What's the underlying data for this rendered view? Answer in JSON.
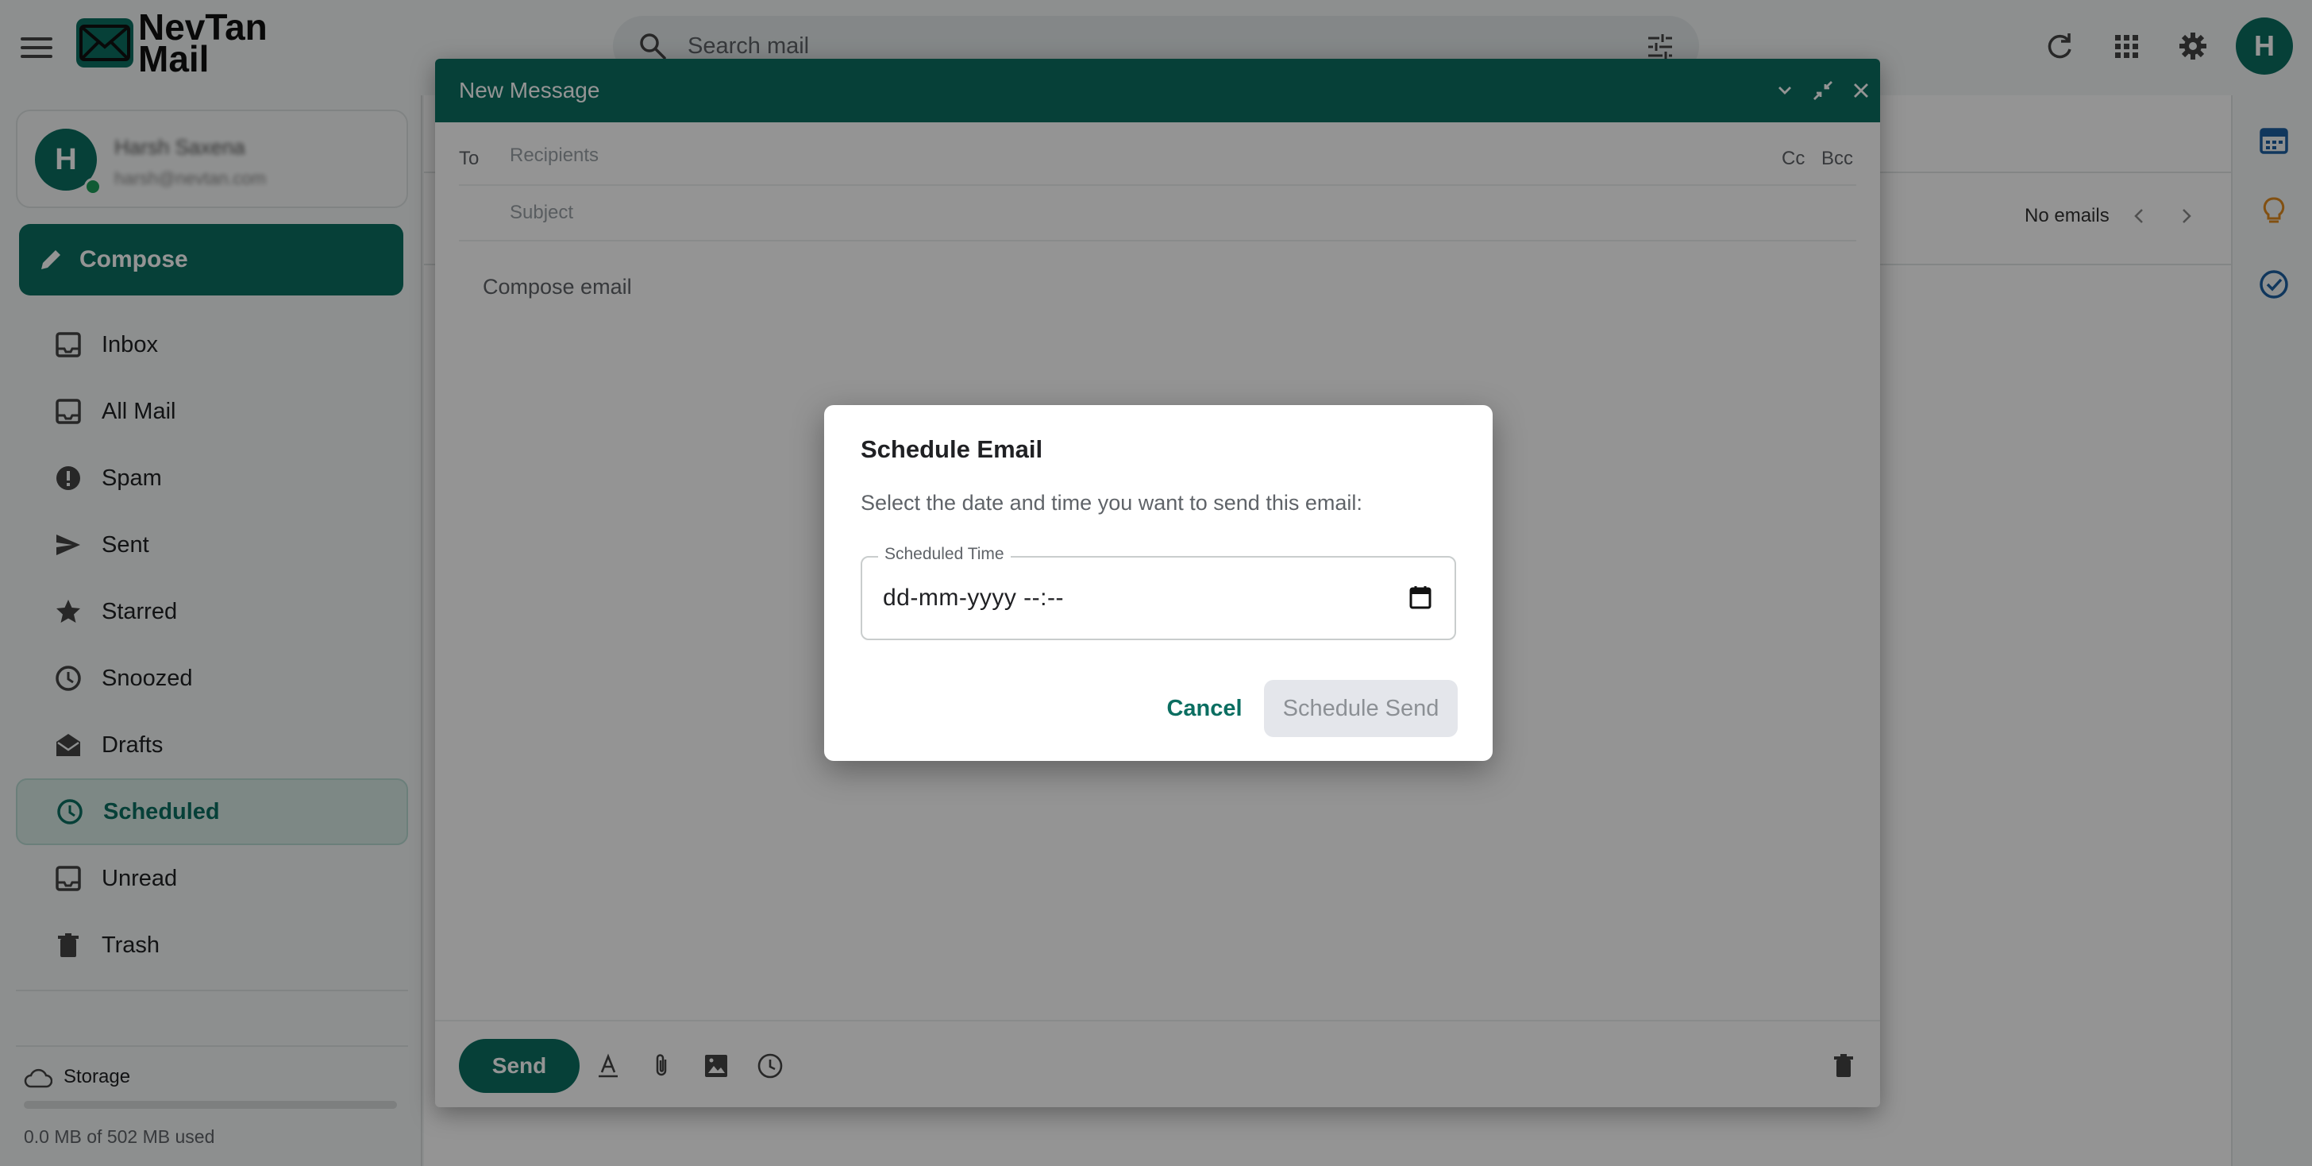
{
  "app": {
    "logo_line1": "NevTan",
    "logo_line2": "Mail",
    "avatar_initial": "H",
    "accent_color": "#0b6e61"
  },
  "search": {
    "placeholder": "Search mail"
  },
  "topbar_icons": [
    "menu-icon",
    "search-icon",
    "tune-icon",
    "refresh-icon",
    "apps-grid-icon",
    "gear-icon"
  ],
  "profile": {
    "initial": "H",
    "name": "Harsh Saxena",
    "email": "harsh@nevtan.com"
  },
  "sidebar": {
    "compose_label": "Compose",
    "items": [
      {
        "label": "Inbox",
        "icon": "inbox-icon"
      },
      {
        "label": "All Mail",
        "icon": "all-mail-icon"
      },
      {
        "label": "Spam",
        "icon": "spam-icon"
      },
      {
        "label": "Sent",
        "icon": "send-icon"
      },
      {
        "label": "Starred",
        "icon": "star-icon"
      },
      {
        "label": "Snoozed",
        "icon": "clock-icon"
      },
      {
        "label": "Drafts",
        "icon": "drafts-icon"
      },
      {
        "label": "Scheduled",
        "icon": "scheduled-icon",
        "active": true
      },
      {
        "label": "Unread",
        "icon": "unread-icon"
      },
      {
        "label": "Trash",
        "icon": "trash-icon"
      }
    ],
    "storage_label": "Storage",
    "storage_text": "0.0 MB of 502 MB used",
    "storage_used_fraction": 0.0
  },
  "main": {
    "pagination_text": "No emails"
  },
  "rightbar_icons": [
    "calendar-icon",
    "lightbulb-icon",
    "tasks-check-icon"
  ],
  "compose_window": {
    "title": "New Message",
    "to_label": "To",
    "recipients_placeholder": "Recipients",
    "cc_label": "Cc",
    "bcc_label": "Bcc",
    "subject_placeholder": "Subject",
    "body_placeholder": "Compose email",
    "send_label": "Send"
  },
  "dialog": {
    "title": "Schedule Email",
    "description": "Select the date and time you want to send this email:",
    "field_label": "Scheduled Time",
    "field_value": "dd-mm-yyyy --:--",
    "cancel_label": "Cancel",
    "schedule_label": "Schedule Send"
  }
}
